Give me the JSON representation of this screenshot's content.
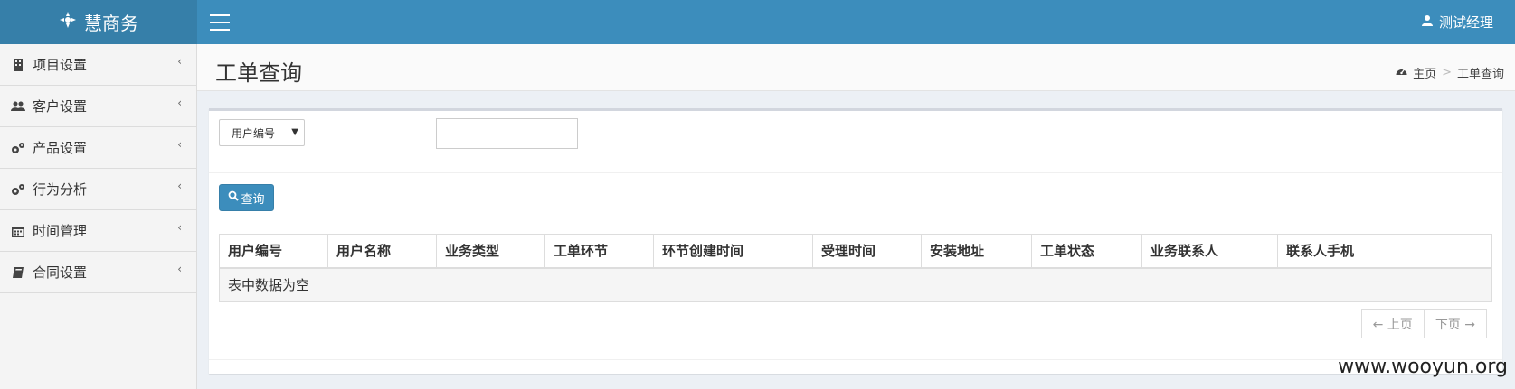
{
  "header": {
    "brand": "慧商务",
    "user_name": "测试经理",
    "colors": {
      "brand_bg": "#367fa9",
      "topbar_bg": "#3c8dbc"
    }
  },
  "sidebar": {
    "items": [
      {
        "label": "项目设置",
        "icon": "building-icon"
      },
      {
        "label": "客户设置",
        "icon": "users-icon"
      },
      {
        "label": "产品设置",
        "icon": "gears-icon"
      },
      {
        "label": "行为分析",
        "icon": "gears-icon"
      },
      {
        "label": "时间管理",
        "icon": "calendar-icon"
      },
      {
        "label": "合同设置",
        "icon": "book-icon"
      }
    ],
    "chevron": "‹"
  },
  "page": {
    "title": "工单查询",
    "breadcrumb_home": "主页",
    "breadcrumb_sep": ">",
    "breadcrumb_current": "工单查询"
  },
  "filter": {
    "field_select": "用户编号",
    "value": "",
    "search_button": "查询"
  },
  "table": {
    "headers": [
      "用户编号",
      "用户名称",
      "业务类型",
      "工单环节",
      "环节创建时间",
      "受理时间",
      "安装地址",
      "工单状态",
      "业务联系人",
      "联系人手机"
    ],
    "empty_text": "表中数据为空"
  },
  "pager": {
    "prev": "← 上页",
    "next": "下页 →"
  },
  "watermark": "www.wooyun.org"
}
